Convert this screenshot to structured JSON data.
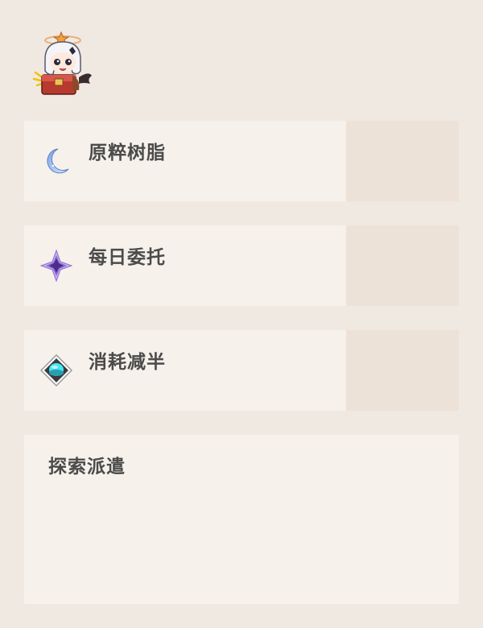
{
  "avatar": {
    "icon": "paimon-chibi-icon"
  },
  "cards": [
    {
      "label": "原粹树脂",
      "icon": "crescent-moon-icon"
    },
    {
      "label": "每日委托",
      "icon": "purple-star-icon"
    },
    {
      "label": "消耗减半",
      "icon": "cyan-orb-diamond-icon"
    }
  ],
  "expedition": {
    "label": "探索派遣"
  },
  "colors": {
    "background": "#f0e9e2",
    "card": "#f6f1eb",
    "card_side": "#ece2d8",
    "text": "#4b4b4b"
  }
}
